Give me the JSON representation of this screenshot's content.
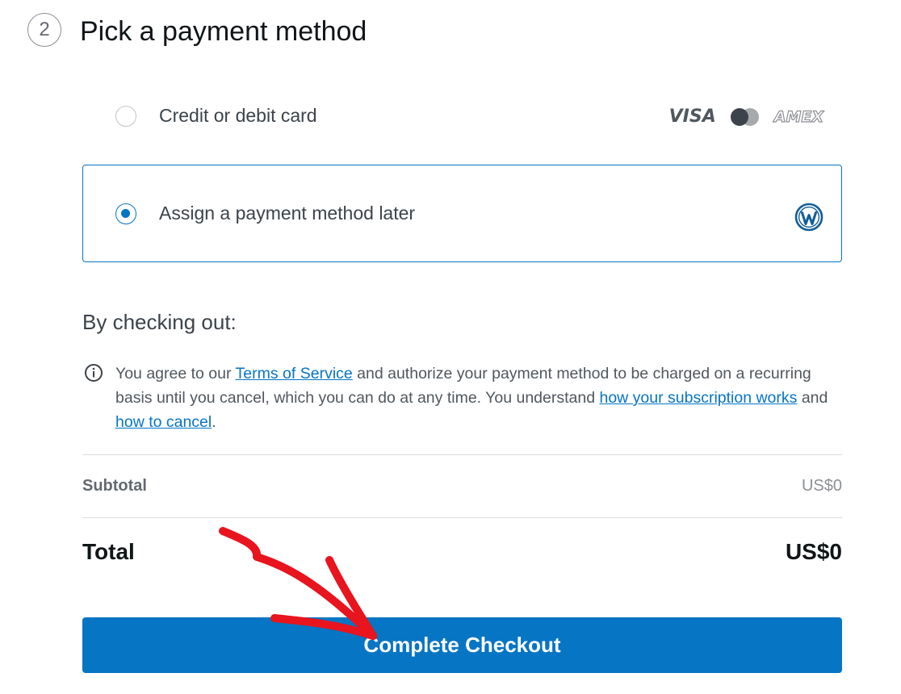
{
  "step": {
    "number": "2",
    "title": "Pick a payment method"
  },
  "payment_options": {
    "card": {
      "label": "Credit or debit card",
      "selected": false,
      "logos": {
        "visa": "VISA",
        "amex": "AMEX",
        "mastercard": "mastercard-icon"
      }
    },
    "later": {
      "label": "Assign a payment method later",
      "selected": true,
      "icon": "wordpress-icon"
    }
  },
  "checkout_terms": {
    "heading": "By checking out:",
    "text_1": "You agree to our ",
    "terms_link": "Terms of Service",
    "text_2": " and authorize your payment method to be charged on a recurring basis until you cancel, which you can do at any time. You understand ",
    "subscription_link": "how your subscription works",
    "text_3": " and ",
    "cancel_link": "how to cancel",
    "text_4": "."
  },
  "summary": {
    "subtotal_label": "Subtotal",
    "subtotal_value": "US$0",
    "total_label": "Total",
    "total_value": "US$0"
  },
  "checkout_button": {
    "label": "Complete Checkout"
  },
  "colors": {
    "accent": "#0675c4",
    "annotation_arrow": "#e8141e"
  }
}
